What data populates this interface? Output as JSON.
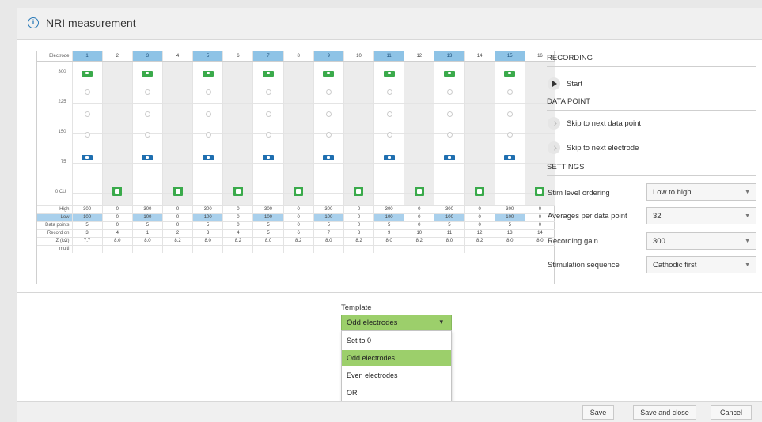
{
  "window": {
    "title": "NRI measurement",
    "title_icon": "info-icon"
  },
  "grid": {
    "electrode_label": "Electrode",
    "electrodes": [
      "1",
      "2",
      "3",
      "4",
      "5",
      "6",
      "7",
      "8",
      "9",
      "10",
      "11",
      "12",
      "13",
      "14",
      "15",
      "16"
    ],
    "y_ticks": [
      "300",
      "225",
      "150",
      "75",
      "0 CU"
    ],
    "row_labels": {
      "high": "High",
      "low": "Low",
      "data_points": "Data points",
      "record_on": "Record on",
      "z": "Z (kΩ)",
      "multi": "multi"
    },
    "high": [
      "300",
      "0",
      "300",
      "0",
      "300",
      "0",
      "300",
      "0",
      "300",
      "0",
      "300",
      "0",
      "300",
      "0",
      "300",
      "0"
    ],
    "low": [
      "100",
      "0",
      "100",
      "0",
      "100",
      "0",
      "100",
      "0",
      "100",
      "0",
      "100",
      "0",
      "100",
      "0",
      "100",
      "0"
    ],
    "data_points": [
      "5",
      "0",
      "5",
      "0",
      "5",
      "0",
      "5",
      "0",
      "5",
      "0",
      "5",
      "0",
      "5",
      "0",
      "5",
      "0"
    ],
    "record_on": [
      "3",
      "4",
      "1",
      "2",
      "3",
      "4",
      "5",
      "6",
      "7",
      "8",
      "9",
      "10",
      "11",
      "12",
      "13",
      "14"
    ],
    "z": [
      "7.7",
      "8.0",
      "8.0",
      "8.2",
      "8.0",
      "8.2",
      "8.0",
      "8.2",
      "8.0",
      "8.2",
      "8.0",
      "8.2",
      "8.0",
      "8.2",
      "8.0",
      "8.0"
    ]
  },
  "recording": {
    "title": "RECORDING",
    "start_label": "Start"
  },
  "data_point": {
    "title": "DATA POINT",
    "skip_point": "Skip to next data point",
    "skip_electrode": "Skip to next electrode"
  },
  "settings": {
    "title": "SETTINGS",
    "stim_ordering": {
      "label": "Stim level ordering",
      "value": "Low to high"
    },
    "averages": {
      "label": "Averages per data point",
      "value": "32"
    },
    "gain": {
      "label": "Recording gain",
      "value": "300"
    },
    "sequence": {
      "label": "Stimulation sequence",
      "value": "Cathodic first"
    }
  },
  "template": {
    "label": "Template",
    "selected": "Odd electrodes",
    "options": [
      "Set to 0",
      "Odd electrodes",
      "Even electrodes",
      "OR"
    ]
  },
  "footer": {
    "save": "Save",
    "save_close": "Save and close",
    "cancel": "Cancel"
  }
}
